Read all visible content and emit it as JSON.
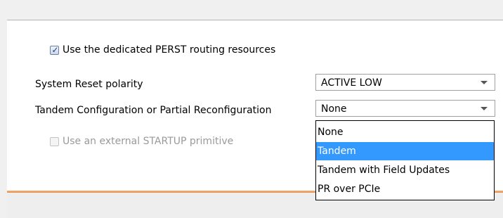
{
  "options_panel": {
    "perst_checkbox": {
      "label": "Use the dedicated PERST routing resources",
      "checked": true
    },
    "system_reset": {
      "label": "System Reset polarity",
      "value": "ACTIVE LOW"
    },
    "tandem": {
      "label": "Tandem Configuration or Partial Reconfiguration",
      "value": "None",
      "options": [
        "None",
        "Tandem",
        "Tandem with Field Updates",
        "PR over PCIe"
      ],
      "highlighted": "Tandem"
    },
    "startup_checkbox": {
      "label": "Use an external STARTUP primitive",
      "checked": false,
      "disabled": true
    }
  },
  "colors": {
    "highlight": "#3399ff",
    "accent_bar": "#e8893c",
    "disabled_text": "#9a9a9a"
  },
  "icons": {
    "combo_arrow": "chevron-down-icon",
    "check": "checkmark-icon"
  }
}
